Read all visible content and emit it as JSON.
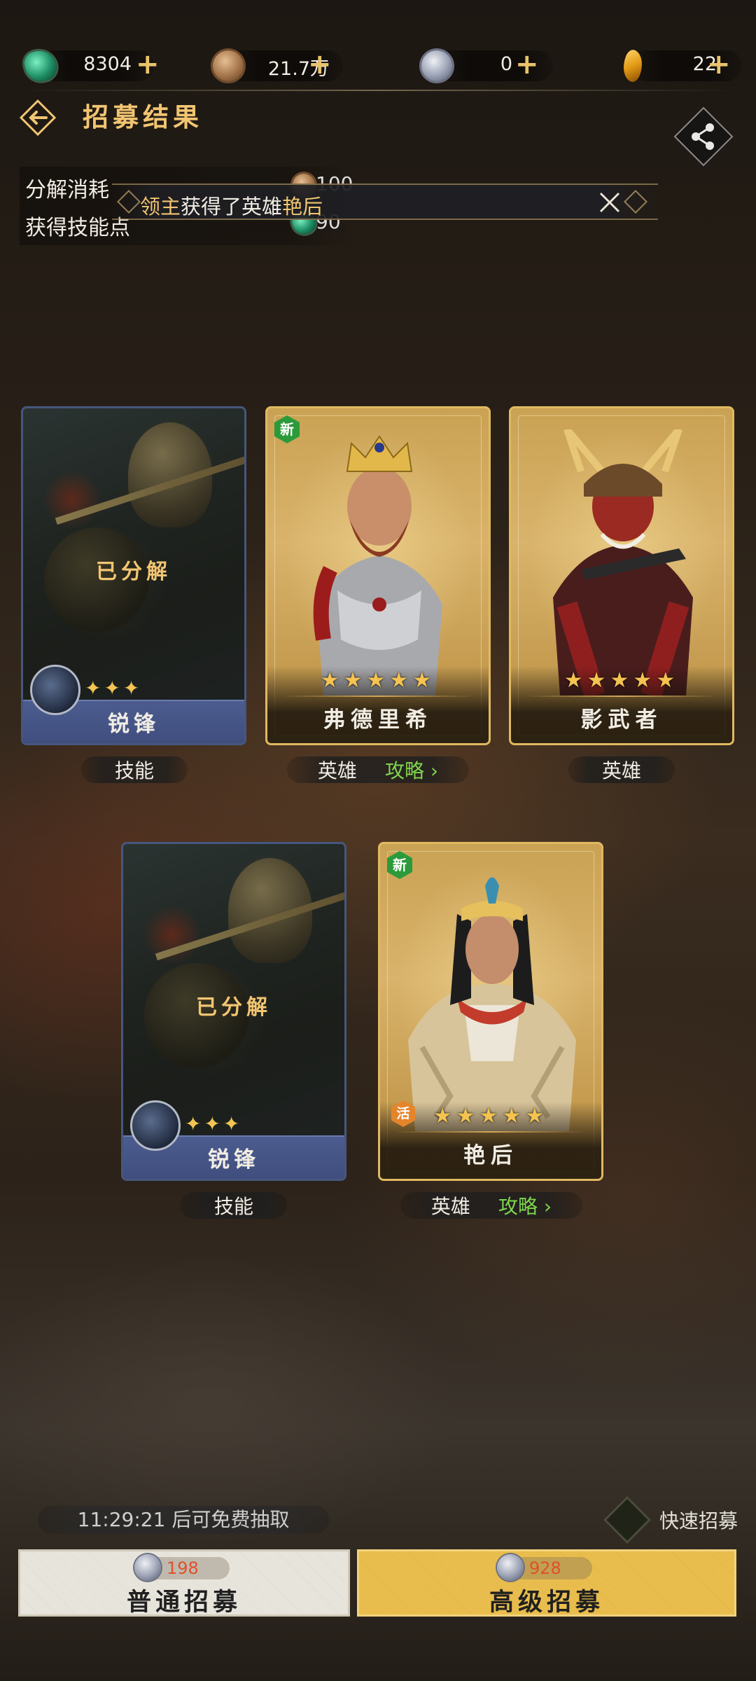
{
  "resources": [
    {
      "icon": "gem-icon",
      "value": "8304"
    },
    {
      "icon": "copper-coin-icon",
      "value": "21.7万"
    },
    {
      "icon": "silver-coin-icon",
      "value": "0"
    },
    {
      "icon": "crystal-icon",
      "value": "22"
    }
  ],
  "header": {
    "title": "招募结果"
  },
  "decompose": {
    "cost_label": "分解消耗",
    "cost_value": "100",
    "skill_points_label": "获得技能点",
    "skill_points_value": "90"
  },
  "toast": {
    "prefix": "领主",
    "middle": "获得了英雄",
    "hero": "艳后"
  },
  "cards": [
    {
      "type": "skill",
      "status": "已分解",
      "name": "锐锋",
      "stars": 3,
      "tag": "技能"
    },
    {
      "type": "hero",
      "new": "新",
      "name": "弗德里希",
      "stars": 5,
      "tag": "英雄",
      "guide": "攻略"
    },
    {
      "type": "hero",
      "name": "影武者",
      "stars": 5,
      "tag": "英雄"
    },
    {
      "type": "skill",
      "status": "已分解",
      "name": "锐锋",
      "stars": 3,
      "tag": "技能"
    },
    {
      "type": "hero",
      "new": "新",
      "active": "活",
      "name": "艳后",
      "stars": 5,
      "tag": "英雄",
      "guide": "攻略"
    }
  ],
  "star_glyph_5": "★★★★★",
  "star_glyph_3": "✦✦✦",
  "footer": {
    "timer": "11:29:21 后可免费抽取",
    "quick_label": "快速招募",
    "normal": {
      "cost": "198",
      "label": "普通招募"
    },
    "advanced": {
      "cost": "928",
      "label": "高级招募"
    }
  }
}
